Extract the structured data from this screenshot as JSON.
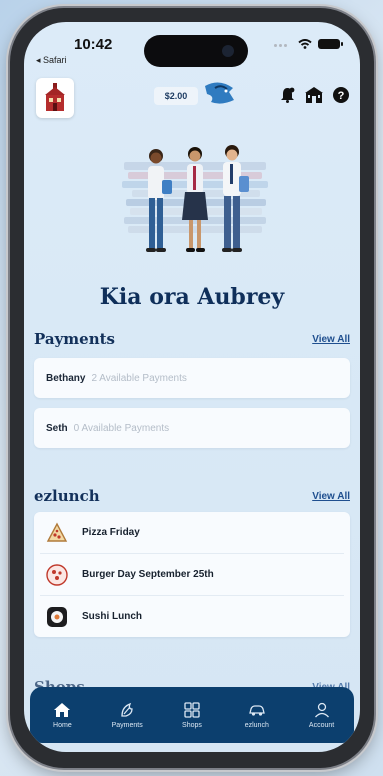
{
  "status": {
    "time": "10:42",
    "back_label": "◂ Safari"
  },
  "header": {
    "balance": "$2.00"
  },
  "greeting": "Kia ora Aubrey",
  "payments": {
    "title": "Payments",
    "view_all": "View All",
    "rows": [
      {
        "name": "Bethany",
        "summary": "2 Available Payments"
      },
      {
        "name": "Seth",
        "summary": "0 Available Payments"
      }
    ]
  },
  "ezlunch": {
    "title": "ezlunch",
    "view_all": "View All",
    "items": [
      {
        "label": "Pizza Friday",
        "icon": "pizza-icon"
      },
      {
        "label": "Burger Day September 25th",
        "icon": "pepperoni-icon"
      },
      {
        "label": "Sushi Lunch",
        "icon": "sushi-icon"
      }
    ]
  },
  "shops": {
    "title": "Shops",
    "view_all": "View All"
  },
  "nav": {
    "items": [
      {
        "label": "Home",
        "icon": "home-icon"
      },
      {
        "label": "Payments",
        "icon": "payments-icon"
      },
      {
        "label": "Shops",
        "icon": "shops-icon"
      },
      {
        "label": "ezlunch",
        "icon": "car-icon"
      },
      {
        "label": "Account",
        "icon": "account-icon"
      }
    ]
  },
  "colors": {
    "brand_navy": "#0c3f6e",
    "heading": "#12305a",
    "screen_bg": "#dcebf8"
  }
}
